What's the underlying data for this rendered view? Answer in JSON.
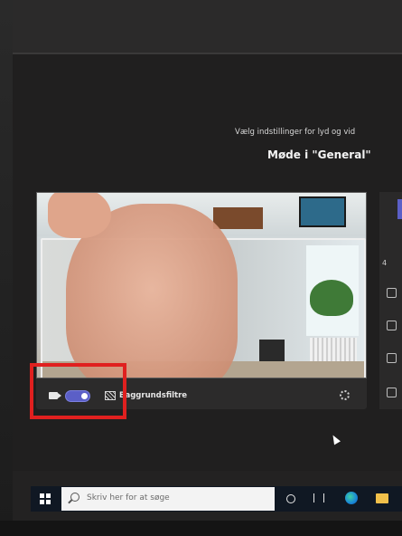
{
  "prejoin": {
    "subtitle": "Vælg indstillinger for lyd og vid",
    "meeting_title": "Møde i \"General\""
  },
  "controls": {
    "camera_toggle_on": true,
    "background_filters_label": "Baggrundsfiltre"
  },
  "right_panel": {
    "partial_text": "4"
  },
  "taskbar": {
    "search_placeholder": "Skriv her for at søge"
  },
  "colors": {
    "accent": "#5b5fc7",
    "annotation_red": "#e0201f",
    "taskbar": "#101823"
  },
  "icons": [
    "camera-icon",
    "background-filter-icon",
    "settings-gear-icon",
    "windows-logo-icon",
    "search-icon",
    "cortana-icon",
    "task-view-icon",
    "edge-browser-icon",
    "file-explorer-icon"
  ]
}
